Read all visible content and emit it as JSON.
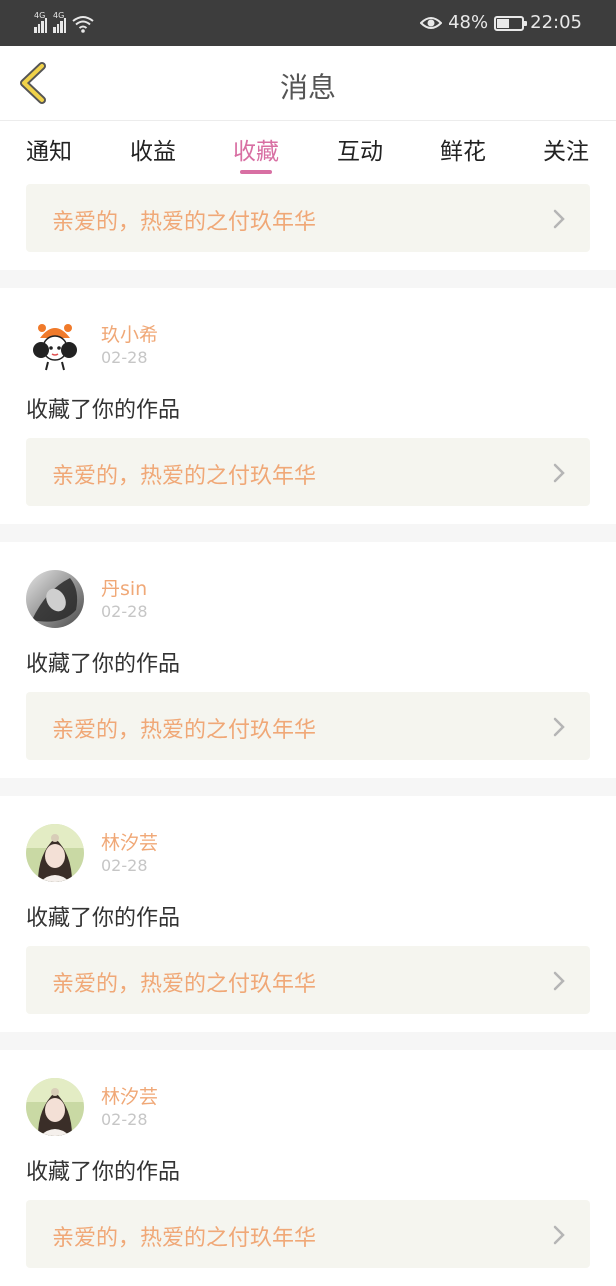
{
  "status_bar": {
    "network_1": "4G",
    "network_2": "4G",
    "battery_percent": "48%",
    "battery_level": 0.48,
    "time": "22:05",
    "icons": [
      "signal-icon",
      "signal-icon",
      "wifi-icon",
      "eye-icon",
      "battery-icon"
    ]
  },
  "header": {
    "title": "消息",
    "back_icon": "chevron-left-icon"
  },
  "tabs": [
    {
      "label": "通知",
      "active": false
    },
    {
      "label": "收益",
      "active": false
    },
    {
      "label": "收藏",
      "active": true
    },
    {
      "label": "互动",
      "active": false
    },
    {
      "label": "鲜花",
      "active": false
    },
    {
      "label": "关注",
      "active": false
    }
  ],
  "top_card": {
    "work_title": "亲爱的，热爱的之付玖年华"
  },
  "items": [
    {
      "user": "玖小希",
      "date": "02-28",
      "action": "收藏了你的作品",
      "work_title": "亲爱的，热爱的之付玖年华",
      "avatar": "cartoon-avatar"
    },
    {
      "user": "丹sin",
      "date": "02-28",
      "action": "收藏了你的作品",
      "work_title": "亲爱的，热爱的之付玖年华",
      "avatar": "bw-photo-avatar"
    },
    {
      "user": "林汐芸",
      "date": "02-28",
      "action": "收藏了你的作品",
      "work_title": "亲爱的，热爱的之付玖年华",
      "avatar": "photo-avatar"
    },
    {
      "user": "林汐芸",
      "date": "02-28",
      "action": "收藏了你的作品",
      "work_title": "亲爱的，热爱的之付玖年华",
      "avatar": "photo-avatar"
    }
  ],
  "colors": {
    "accent": "#d86fa3",
    "work_title": "#f0a877",
    "card_bg": "#f5f5ef",
    "status_bar": "#3d3d3d",
    "back_chevron": "#f0d24a"
  }
}
